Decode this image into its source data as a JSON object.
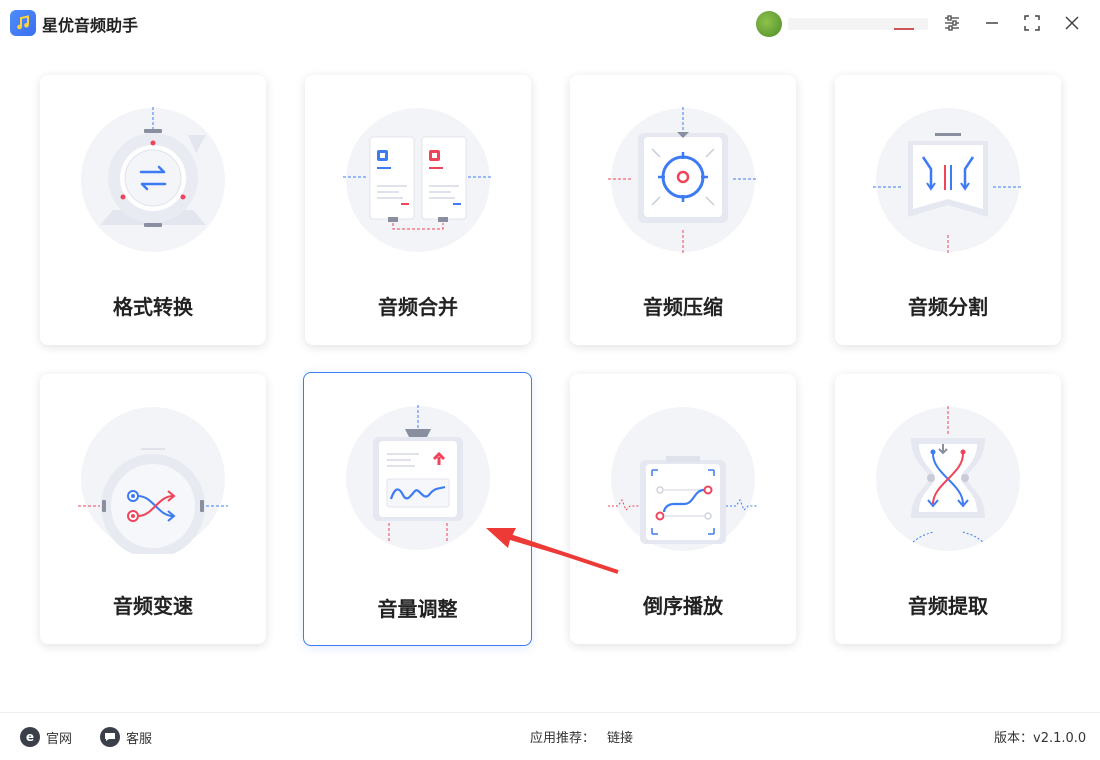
{
  "app": {
    "title": "星优音频助手",
    "logo_icon": "music-note-icon",
    "accent": "#3d7bf5",
    "secondary": "#f0445a"
  },
  "user": {
    "avatar_icon": "user-avatar"
  },
  "window_controls": [
    "settings-icon",
    "minimize-icon",
    "maximize-icon",
    "close-icon"
  ],
  "cards": [
    {
      "label": "格式转换",
      "icon": "format-convert-icon"
    },
    {
      "label": "音频合并",
      "icon": "audio-merge-icon"
    },
    {
      "label": "音频压缩",
      "icon": "audio-compress-icon"
    },
    {
      "label": "音频分割",
      "icon": "audio-split-icon"
    },
    {
      "label": "音频变速",
      "icon": "audio-speed-icon"
    },
    {
      "label": "音量调整",
      "icon": "volume-adjust-icon"
    },
    {
      "label": "倒序播放",
      "icon": "reverse-play-icon"
    },
    {
      "label": "音频提取",
      "icon": "audio-extract-icon"
    }
  ],
  "selected_card": "音量调整",
  "annotation": {
    "icon": "red-arrow-pointer"
  },
  "footer": {
    "site_label": "官网",
    "service_label": "客服",
    "recommend_label": "应用推荐：",
    "recommend_link": "链接",
    "version_text": "版本：v2.1.0.0"
  }
}
